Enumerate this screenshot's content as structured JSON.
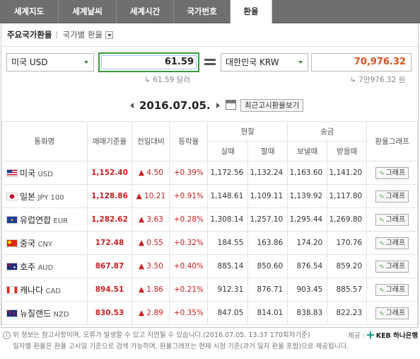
{
  "tabs": [
    "세계지도",
    "세계날씨",
    "세계시간",
    "국가번호",
    "환율"
  ],
  "active_tab_index": 4,
  "subheader": {
    "title": "주요국가환율",
    "dropdown_label": "국가별 환율"
  },
  "converter": {
    "from_currency": "미국 USD",
    "amount": "61.59",
    "amount_text": "61.59 달러",
    "to_currency": "대한민국 KRW",
    "result": "70,976.32",
    "result_text": "7만976.32 원"
  },
  "date": "2016.07.05.",
  "recent_button": "최근고시환율보기",
  "table": {
    "headers": {
      "name": "통화명",
      "base": "매매기준율",
      "change": "전일대비",
      "rate": "등락율",
      "cash": "현찰",
      "cash_buy": "살때",
      "cash_sell": "팔때",
      "remit": "송금",
      "remit_send": "보낼때",
      "remit_recv": "받을때",
      "graph": "환율그래프"
    },
    "rows": [
      {
        "name": "미국",
        "code": "USD",
        "flag": "us-flag",
        "base": "1,152.40",
        "change": "▲ 4.50",
        "rate": "+0.39%",
        "cash_buy": "1,172.56",
        "cash_sell": "1,132.24",
        "send": "1,163.60",
        "recv": "1,141.20",
        "graph": "그래프"
      },
      {
        "name": "일본",
        "code": "JPY 100",
        "flag": "jp-flag",
        "base": "1,128.86",
        "change": "▲ 10.21",
        "rate": "+0.91%",
        "cash_buy": "1,148.61",
        "cash_sell": "1,109.11",
        "send": "1,139.92",
        "recv": "1,117.80",
        "graph": "그래프"
      },
      {
        "name": "유럽연합",
        "code": "EUR",
        "flag": "eu-flag",
        "base": "1,282.62",
        "change": "▲ 3.63",
        "rate": "+0.28%",
        "cash_buy": "1,308.14",
        "cash_sell": "1,257.10",
        "send": "1,295.44",
        "recv": "1,269.80",
        "graph": "그래프"
      },
      {
        "name": "중국",
        "code": "CNY",
        "flag": "cn-flag",
        "base": "172.48",
        "change": "▲ 0.55",
        "rate": "+0.32%",
        "cash_buy": "184.55",
        "cash_sell": "163.86",
        "send": "174.20",
        "recv": "170.76",
        "graph": "그래프"
      },
      {
        "name": "호주",
        "code": "AUD",
        "flag": "au-flag",
        "base": "867.87",
        "change": "▲ 3.50",
        "rate": "+0.40%",
        "cash_buy": "885.14",
        "cash_sell": "850.60",
        "send": "876.54",
        "recv": "859.20",
        "graph": "그래프"
      },
      {
        "name": "캐나다",
        "code": "CAD",
        "flag": "ca-flag",
        "base": "894.51",
        "change": "▲ 1.86",
        "rate": "+0.21%",
        "cash_buy": "912.31",
        "cash_sell": "876.71",
        "send": "903.45",
        "recv": "885.57",
        "graph": "그래프"
      },
      {
        "name": "뉴질랜드",
        "code": "NZD",
        "flag": "nz-flag",
        "base": "830.53",
        "change": "▲ 2.89",
        "rate": "+0.35%",
        "cash_buy": "847.05",
        "cash_sell": "814.01",
        "send": "838.83",
        "recv": "822.23",
        "graph": "그래프"
      }
    ]
  },
  "footer": {
    "line1": "위 정보는 참고사항이며, 오류가 발생할 수 있고 지연될 수 있습니다.(2016.07.05. 13:37 170회차기준)",
    "line2": "일자별 환율은 환율 고시일 기준으로 검색 가능하며, 환율그래프는 현재 시점 기준(과거 일자 환율 포함)으로 제공됩니다.",
    "source_label": "제공 :",
    "source_name": "KEB 하나은행"
  },
  "colors": {
    "accent_green": "#3a9a3a",
    "up_red": "#c62020",
    "result_orange": "#d2521e",
    "tab_bg": "#6f6f6f"
  }
}
